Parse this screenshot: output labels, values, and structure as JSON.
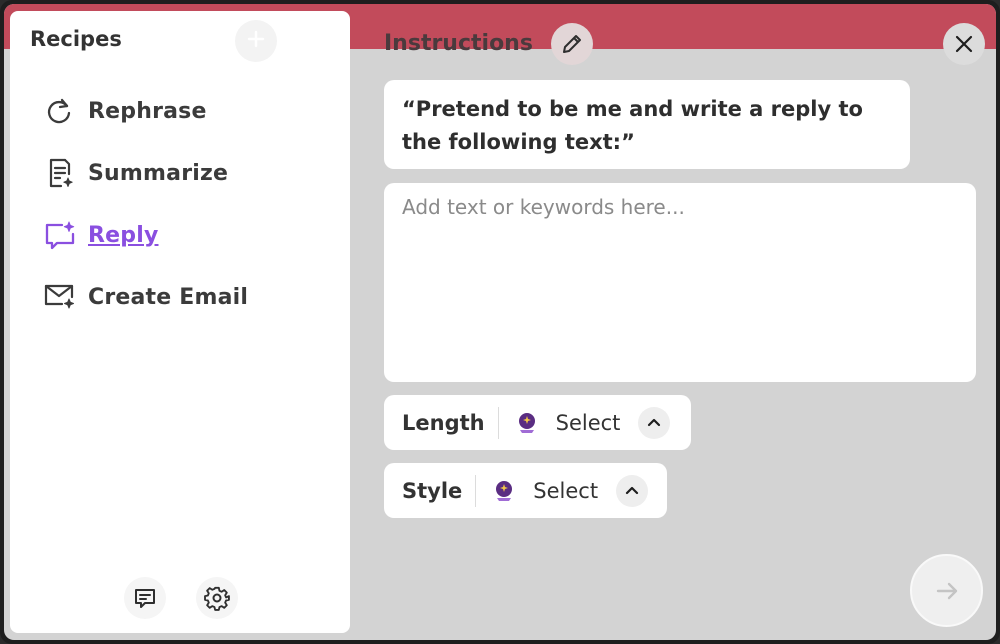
{
  "sidebar": {
    "title": "Recipes",
    "add_icon": "plus-icon",
    "items": [
      {
        "label": "Rephrase",
        "icon": "refresh-icon",
        "active": false
      },
      {
        "label": "Summarize",
        "icon": "document-sparkle-icon",
        "active": false
      },
      {
        "label": "Reply",
        "icon": "chat-sparkle-icon",
        "active": true
      },
      {
        "label": "Create Email",
        "icon": "mail-sparkle-icon",
        "active": false
      }
    ],
    "footer_icons": [
      "feedback-icon",
      "gear-icon"
    ]
  },
  "content": {
    "title": "Instructions",
    "prompt": "“Pretend to be me and write a reply to the following text:”",
    "input": {
      "value": "",
      "placeholder": "Add text or keywords here..."
    },
    "options": [
      {
        "label": "Length",
        "value": "Select",
        "icon": "crystal-ball-icon"
      },
      {
        "label": "Style",
        "value": "Select",
        "icon": "crystal-ball-icon"
      }
    ]
  },
  "colors": {
    "accent": "#8a4fe0",
    "header_band": "#c24b5b",
    "panel_bg": "#d3d3d3"
  }
}
